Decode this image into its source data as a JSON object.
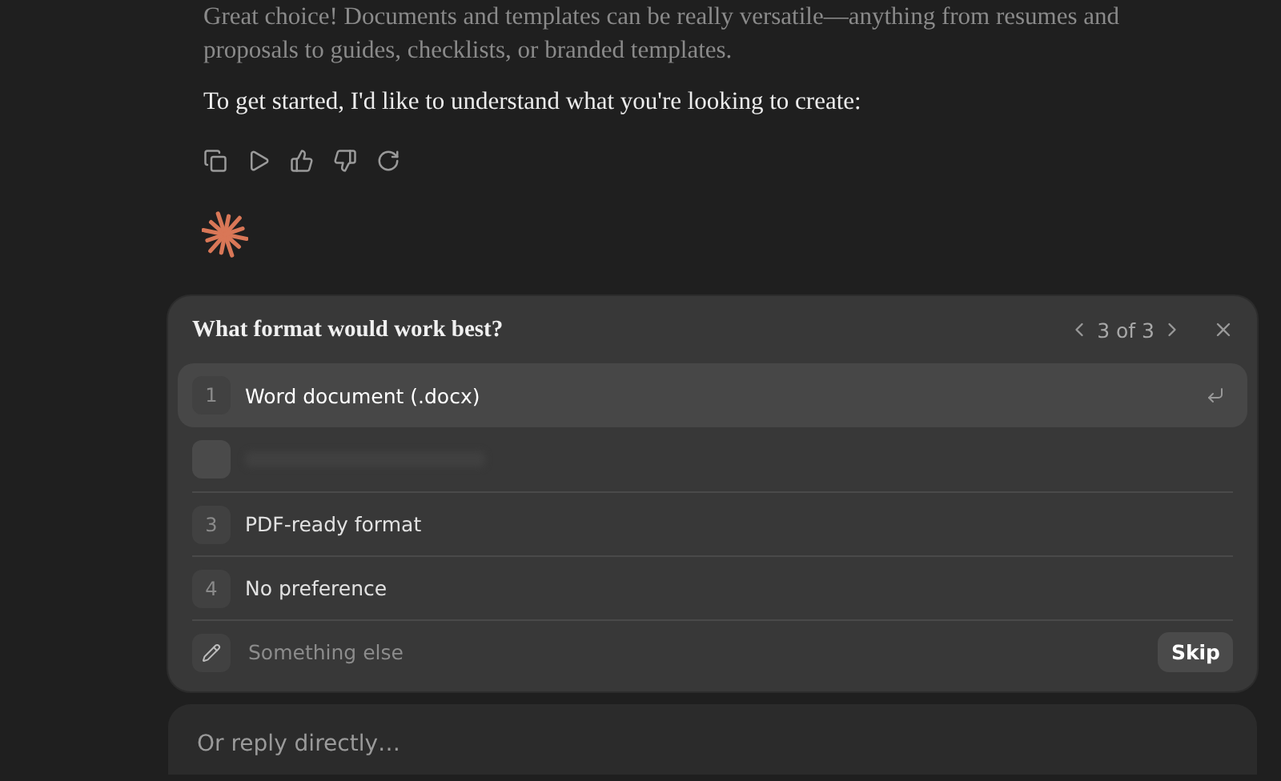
{
  "message": {
    "paragraphs": [
      "Great choice! Documents and templates can be really versatile—anything from resumes and proposals to guides, checklists, or branded templates.",
      "To get started, I'd like to understand what you're looking to create:"
    ]
  },
  "question": {
    "title": "What format would work best?",
    "pager": "3 of 3",
    "options": [
      {
        "kind": "option",
        "number": "1",
        "label": "Word document (.docx)",
        "selected": true
      },
      {
        "kind": "blurred",
        "selected": false
      },
      {
        "kind": "option",
        "number": "3",
        "label": "PDF-ready format",
        "selected": false
      },
      {
        "kind": "option",
        "number": "4",
        "label": "No preference",
        "selected": false
      }
    ],
    "other": {
      "placeholder": "Something else"
    },
    "skip": "Skip"
  },
  "reply": {
    "placeholder": "Or reply directly…"
  }
}
